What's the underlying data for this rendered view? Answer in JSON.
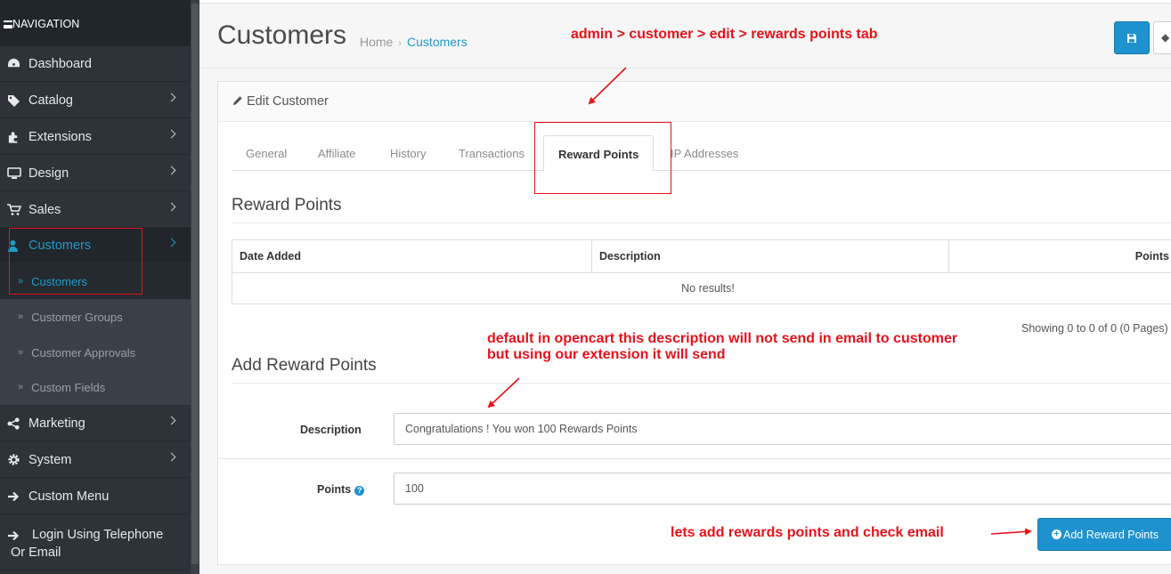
{
  "sidebar": {
    "header": "NAVIGATION",
    "items": [
      {
        "label": "Dashboard",
        "icon": "dashboard-icon"
      },
      {
        "label": "Catalog",
        "icon": "tags-icon"
      },
      {
        "label": "Extensions",
        "icon": "puzzle-icon"
      },
      {
        "label": "Design",
        "icon": "desktop-icon"
      },
      {
        "label": "Sales",
        "icon": "cart-icon"
      },
      {
        "label": "Customers",
        "icon": "user-icon"
      },
      {
        "label": "Marketing",
        "icon": "share-icon"
      },
      {
        "label": "System",
        "icon": "cog-icon"
      },
      {
        "label": "Custom Menu",
        "icon": "arrow-right-icon"
      },
      {
        "label": "Login Using Telephone Or Email",
        "icon": "sign-in-icon"
      }
    ],
    "customers_sub": [
      "Customers",
      "Customer Groups",
      "Customer Approvals",
      "Custom Fields"
    ]
  },
  "header": {
    "title": "Customers",
    "breadcrumb": [
      "Home",
      "Customers"
    ]
  },
  "panel": {
    "heading": "Edit Customer",
    "tabs": [
      "General",
      "Affiliate",
      "History",
      "Transactions",
      "Reward Points",
      "IP Addresses"
    ],
    "active_tab": "Reward Points",
    "reward_title": "Reward Points",
    "table": {
      "headers": [
        "Date Added",
        "Description",
        "Points"
      ],
      "empty": "No results!"
    },
    "pagination": "Showing 0 to 0 of 0 (0 Pages)",
    "add_title": "Add Reward Points",
    "form": {
      "description_label": "Description",
      "description_value": "Congratulations ! You won 100 Rewards Points",
      "points_label": "Points",
      "points_value": "100"
    },
    "add_button": "Add Reward Points"
  },
  "annotations": {
    "top": "admin > customer > edit > rewards points tab",
    "middle_line1": "default in opencart this description will not send in email to customer",
    "middle_line2": "but using our extension it will send",
    "bottom": "lets add rewards points and check email"
  },
  "colors": {
    "sidebar_bg": "#2d3339",
    "accent": "#1e91cf",
    "annotation": "#e8121a"
  }
}
